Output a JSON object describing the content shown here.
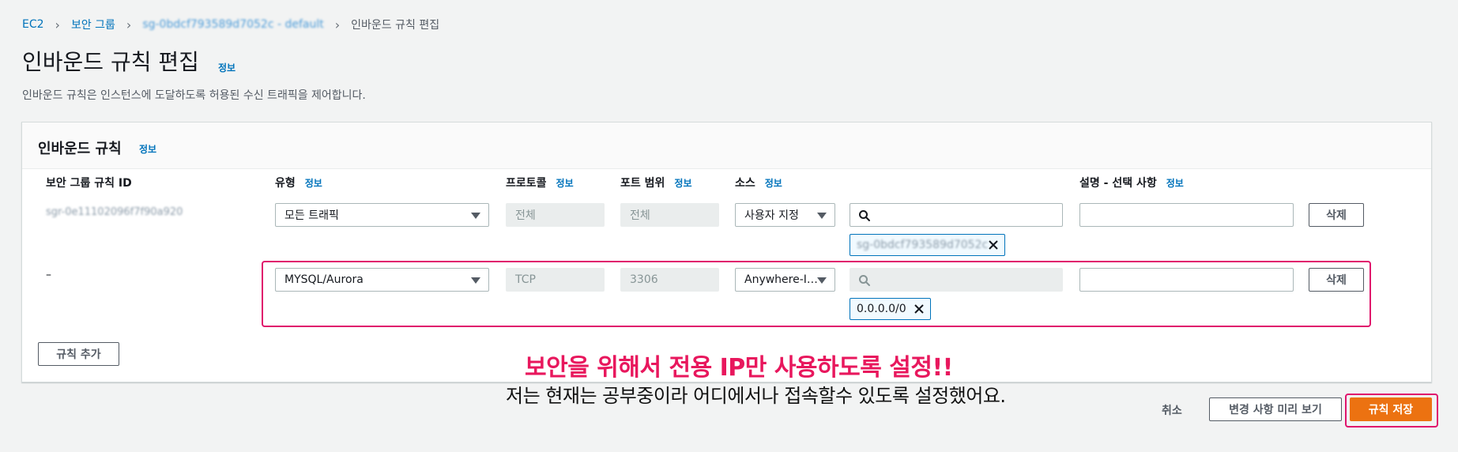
{
  "breadcrumb": {
    "items": [
      "EC2",
      "보안 그룹",
      "sg-0bdcf793589d7052c - default",
      "인바운드 규칙 편집"
    ]
  },
  "page": {
    "title": "인바운드 규칙 편집",
    "info": "정보",
    "description": "인바운드 규칙은 인스턴스에 도달하도록 허용된 수신 트래픽을 제어합니다."
  },
  "panel": {
    "title": "인바운드 규칙",
    "info": "정보",
    "columns": {
      "rule_id": "보안 그룹 규칙 ID",
      "type": "유형",
      "protocol": "프로토콜",
      "port_range": "포트 범위",
      "source": "소스",
      "description": "설명 - 선택 사항",
      "info": "정보"
    },
    "rows": [
      {
        "rule_id": "sgr-0e11102096f7f90a920",
        "type": "모든 트래픽",
        "protocol": "전체",
        "port_range": "전체",
        "source": "사용자 지정",
        "search_value": "",
        "token": "sg-0bdcf793589d7052c",
        "description": "",
        "delete_label": "삭제"
      },
      {
        "rule_id": "–",
        "type": "MYSQL/Aurora",
        "protocol": "TCP",
        "port_range": "3306",
        "source": "Anywhere-I…",
        "search_value": "",
        "token": "0.0.0.0/0",
        "description": "",
        "delete_label": "삭제"
      }
    ],
    "add_rule_label": "규칙 추가"
  },
  "annotation": {
    "line1": "보안을 위해서 전용 IP만 사용하도록 설정!!",
    "line2": "저는 현재는 공부중이라 어디에서나 접속할수 있도록 설정했어요.",
    "color": "#e8175d"
  },
  "footer": {
    "cancel_label": "취소",
    "preview_label": "변경 사항 미리 보기",
    "save_label": "규칙 저장"
  },
  "colors": {
    "link": "#0073bb",
    "primary": "#ec7211",
    "highlight": "#e0146c"
  }
}
